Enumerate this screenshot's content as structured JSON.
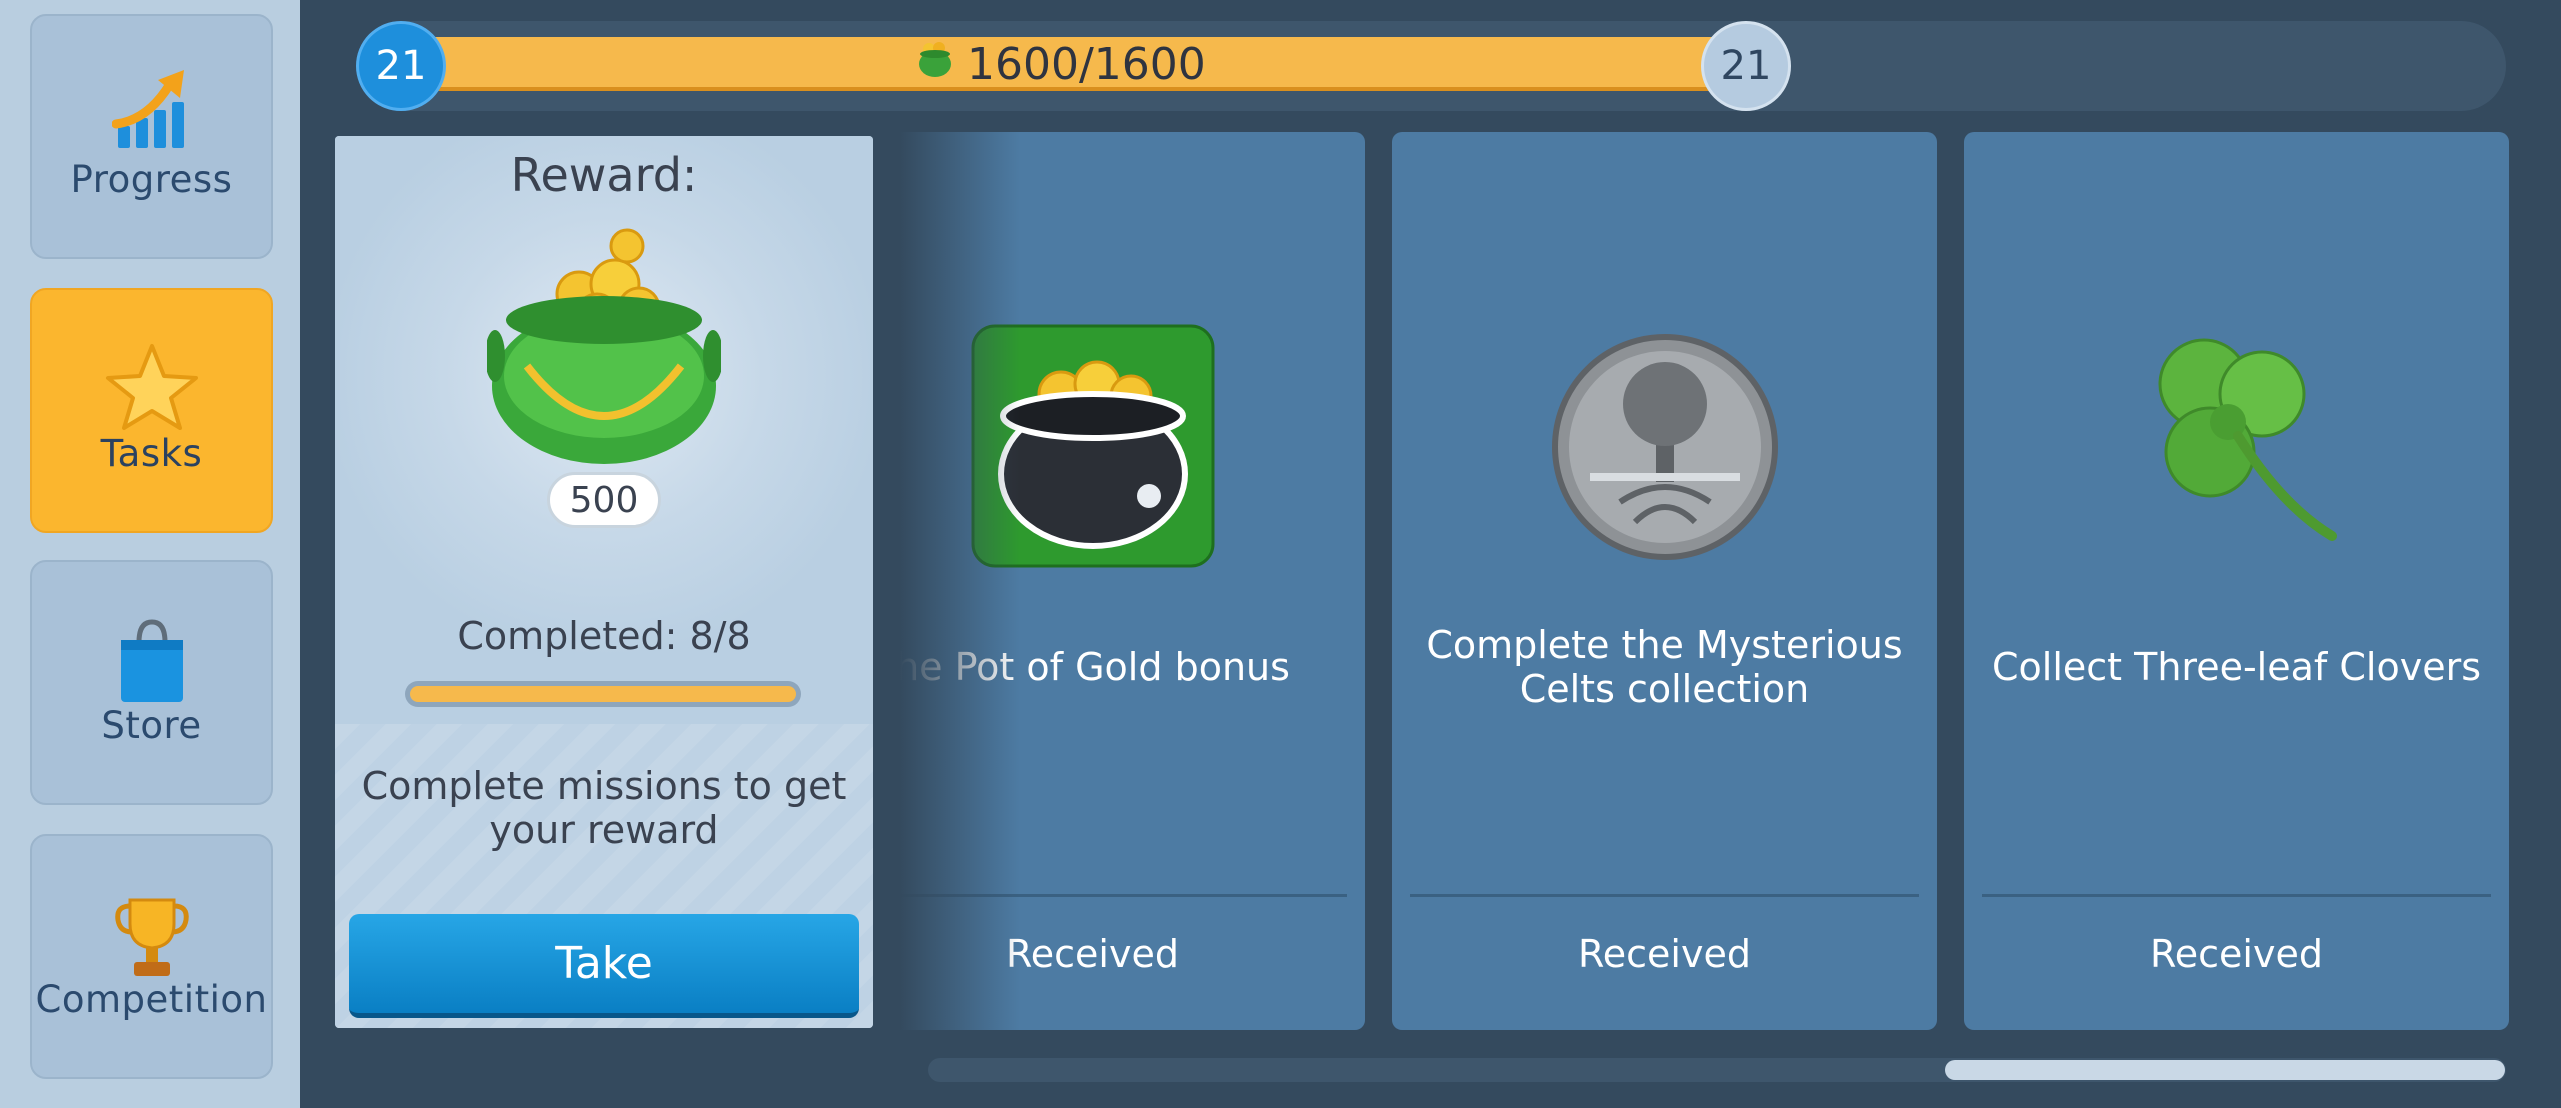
{
  "sidebar": {
    "items": [
      {
        "label": "Progress",
        "icon": "chart-up-arrow-icon",
        "active": false
      },
      {
        "label": "Tasks",
        "icon": "star-icon",
        "active": true
      },
      {
        "label": "Store",
        "icon": "shopping-bag-icon",
        "active": false
      },
      {
        "label": "Competition",
        "icon": "trophy-icon",
        "active": false
      }
    ]
  },
  "level": {
    "current": "21",
    "next": "21",
    "points_text": "1600/1600",
    "progress_fraction": 1.0,
    "icon": "pot-of-gold-icon"
  },
  "reward": {
    "title": "Reward:",
    "amount": "500",
    "completed_text": "Completed: 8/8",
    "progress_fraction": 1.0,
    "description": "Complete missions to get your reward",
    "take_label": "Take"
  },
  "tasks": [
    {
      "title": "he Pot of Gold bonus",
      "status": "Received",
      "icon": "pot-of-gold-icon"
    },
    {
      "title": "Complete the Mysterious Celts collection",
      "status": "Received",
      "icon": "celtic-tree-coin-icon"
    },
    {
      "title": "Collect Three-leaf Clovers",
      "status": "Received",
      "icon": "three-leaf-clover-icon"
    }
  ],
  "colors": {
    "accent": "#fbb62e",
    "button_blue": "#1a93d6",
    "card_blue": "#4d7ba3",
    "background": "#344a5e"
  },
  "scroll": {
    "position_fraction": 1.0
  }
}
